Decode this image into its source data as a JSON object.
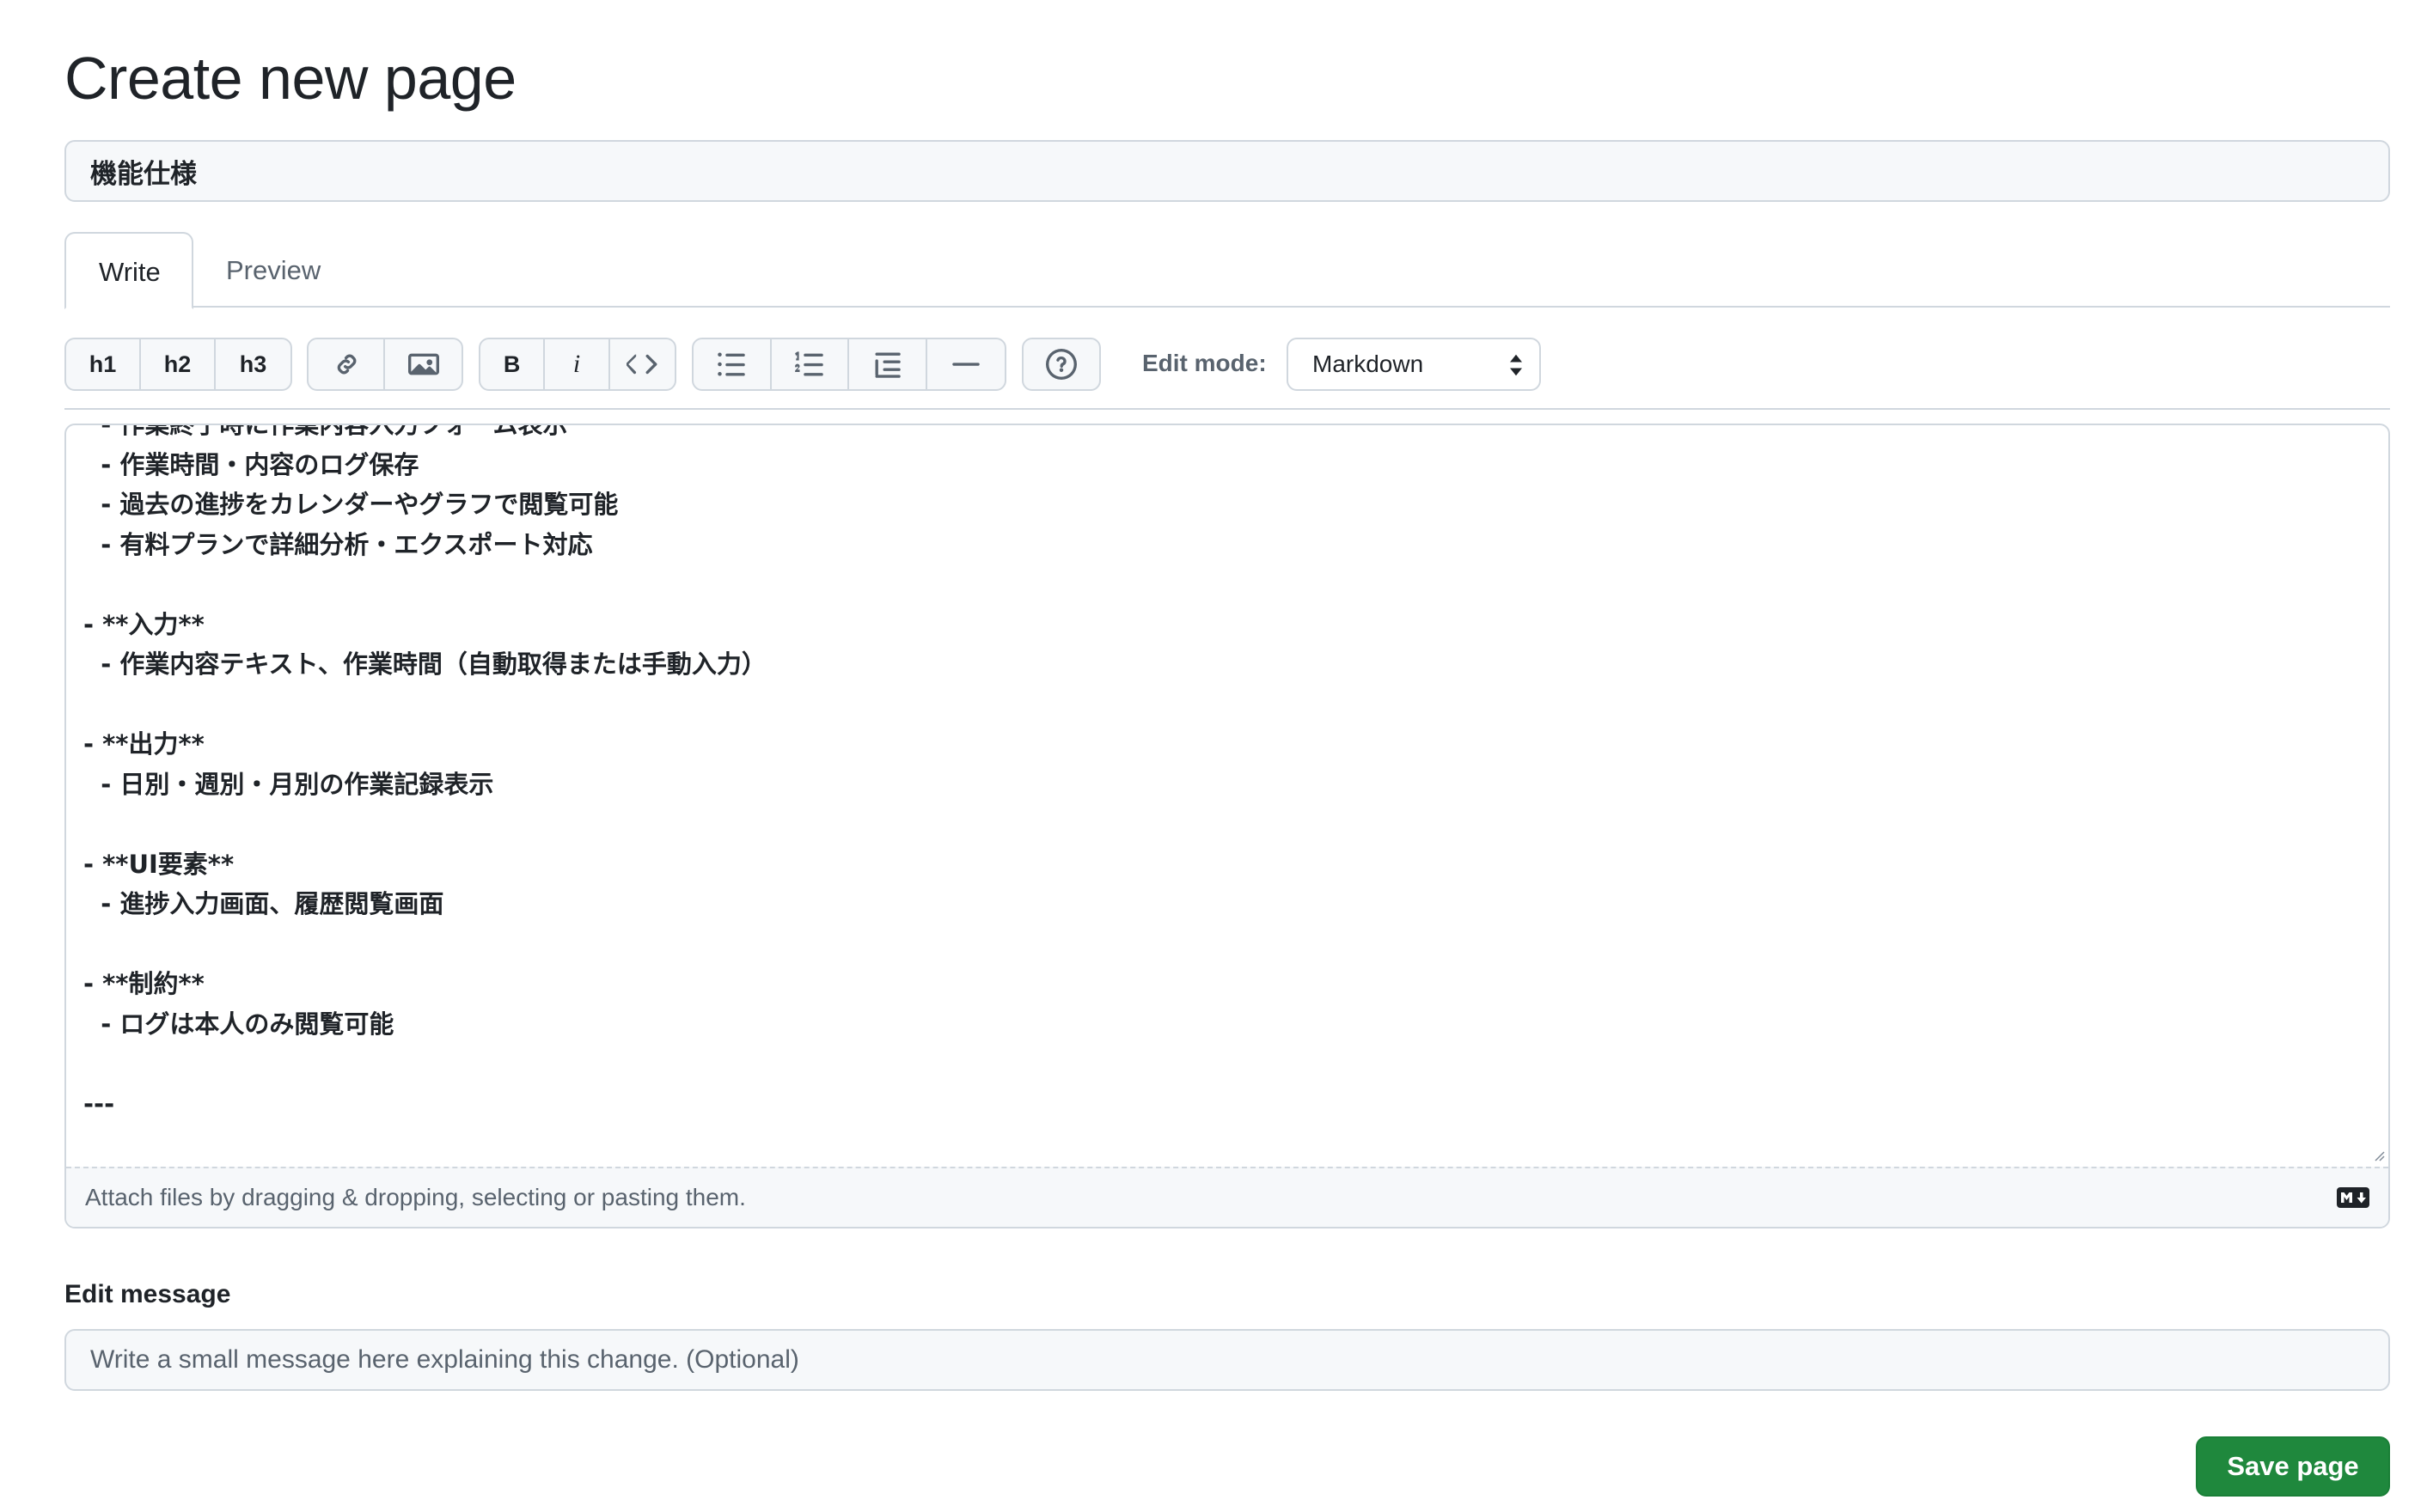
{
  "page": {
    "title": "Create new page"
  },
  "title_input": {
    "value": "機能仕様"
  },
  "tabs": [
    {
      "label": "Write"
    },
    {
      "label": "Preview"
    }
  ],
  "toolbar": {
    "headings": [
      "h1",
      "h2",
      "h3"
    ],
    "bold": "B",
    "italic": "i",
    "edit_mode_label": "Edit mode:",
    "edit_mode_value": "Markdown",
    "icons": [
      "link-icon",
      "image-icon",
      "code-icon",
      "unordered-list-icon",
      "ordered-list-icon",
      "indent-list-icon",
      "horizontal-rule-icon",
      "help-icon"
    ]
  },
  "editor": {
    "lines": [
      "  - 作業終了時に作業内容入力フォーム表示",
      "  - 作業時間・内容のログ保存",
      "  - 過去の進捗をカレンダーやグラフで閲覧可能",
      "  - 有料プランで詳細分析・エクスポート対応",
      "",
      "- **入力**",
      "  - 作業内容テキスト、作業時間（自動取得または手動入力）",
      "",
      "- **出力**",
      "  - 日別・週別・月別の作業記録表示",
      "",
      "- **UI要素**",
      "  - 進捗入力画面、履歴閲覧画面",
      "",
      "- **制約**",
      "  - ログは本人のみ閲覧可能",
      "",
      "---"
    ],
    "attach_text": "Attach files by dragging & dropping, selecting or pasting them."
  },
  "edit_message": {
    "label": "Edit message",
    "placeholder": "Write a small message here explaining this change. (Optional)"
  },
  "save_button": {
    "label": "Save page"
  },
  "colors": {
    "primary": "#1f883d",
    "border": "#d0d7de",
    "muted": "#59636e",
    "text": "#1f2328"
  }
}
